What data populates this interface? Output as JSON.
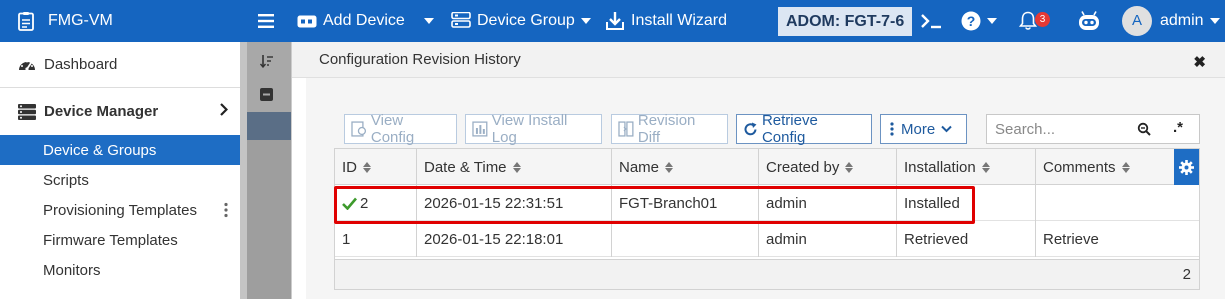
{
  "topbar": {
    "app_name": "FMG-VM",
    "add_device_label": "Add Device",
    "device_group_label": "Device Group",
    "install_wizard_label": "Install Wizard",
    "adom_label": "ADOM: FGT-7-6",
    "notification_count": "3",
    "avatar_letter": "A",
    "user_name": "admin"
  },
  "sidebar": {
    "dashboard_label": "Dashboard",
    "device_manager_label": "Device Manager",
    "items": [
      {
        "label": "Device & Groups",
        "active": true
      },
      {
        "label": "Scripts"
      },
      {
        "label": "Provisioning Templates"
      },
      {
        "label": "Firmware Templates"
      },
      {
        "label": "Monitors"
      }
    ]
  },
  "modal": {
    "title": "Configuration Revision History",
    "close_glyph": "✖",
    "toolbar": {
      "view_config": "View Config",
      "view_install_log": "View Install Log",
      "revision_diff": "Revision Diff",
      "retrieve_config": "Retrieve Config",
      "more": "More",
      "search_placeholder": "Search...",
      "regex_glyph": ".*"
    },
    "table": {
      "columns": [
        "ID",
        "Date & Time",
        "Name",
        "Created by",
        "Installation",
        "Comments"
      ],
      "rows": [
        {
          "id": "2",
          "datetime": "2026-01-15 22:31:51",
          "name": "FGT-Branch01",
          "created_by": "admin",
          "installation": "Installed",
          "comments": "",
          "current": true
        },
        {
          "id": "1",
          "datetime": "2026-01-15 22:18:01",
          "name": "",
          "created_by": "admin",
          "installation": "Retrieved",
          "comments": "Retrieve",
          "current": false
        }
      ],
      "total": "2"
    }
  },
  "colors": {
    "brand_blue": "#1565c0",
    "active_blue": "#1e6dc4",
    "highlight_red": "#e00000",
    "check_green": "#3d9a2c"
  }
}
